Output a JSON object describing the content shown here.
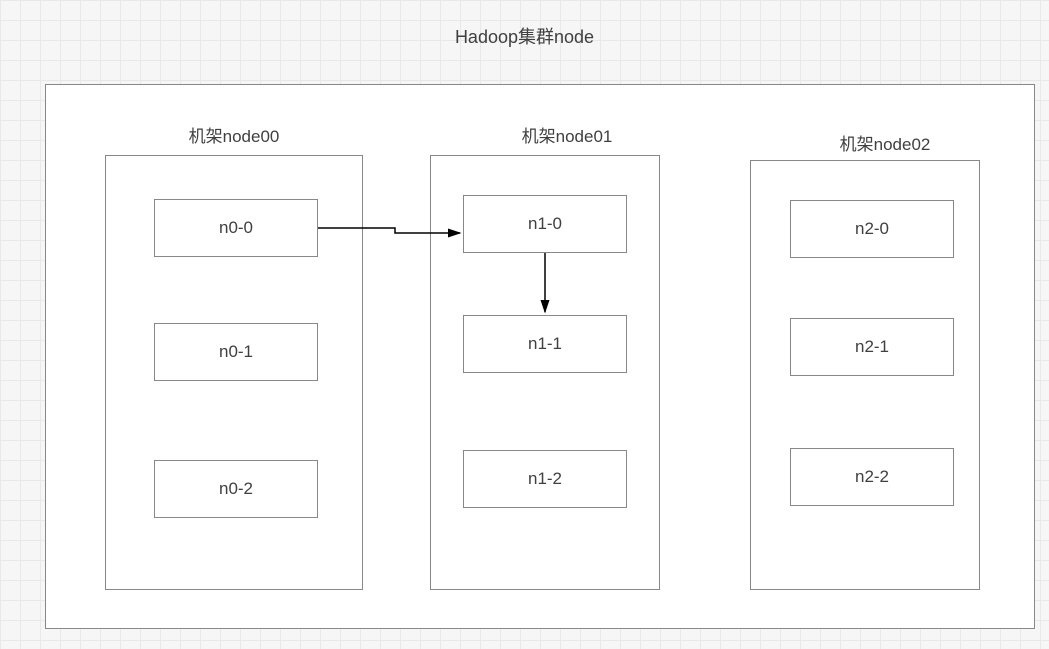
{
  "title": "Hadoop集群node",
  "racks": [
    {
      "label": "机架node00",
      "nodes": [
        "n0-0",
        "n0-1",
        "n0-2"
      ]
    },
    {
      "label": "机架node01",
      "nodes": [
        "n1-0",
        "n1-1",
        "n1-2"
      ]
    },
    {
      "label": "机架node02",
      "nodes": [
        "n2-0",
        "n2-1",
        "n2-2"
      ]
    }
  ],
  "arrows": [
    {
      "from": "n0-0",
      "to": "n1-0"
    },
    {
      "from": "n1-0",
      "to": "n1-1"
    }
  ]
}
